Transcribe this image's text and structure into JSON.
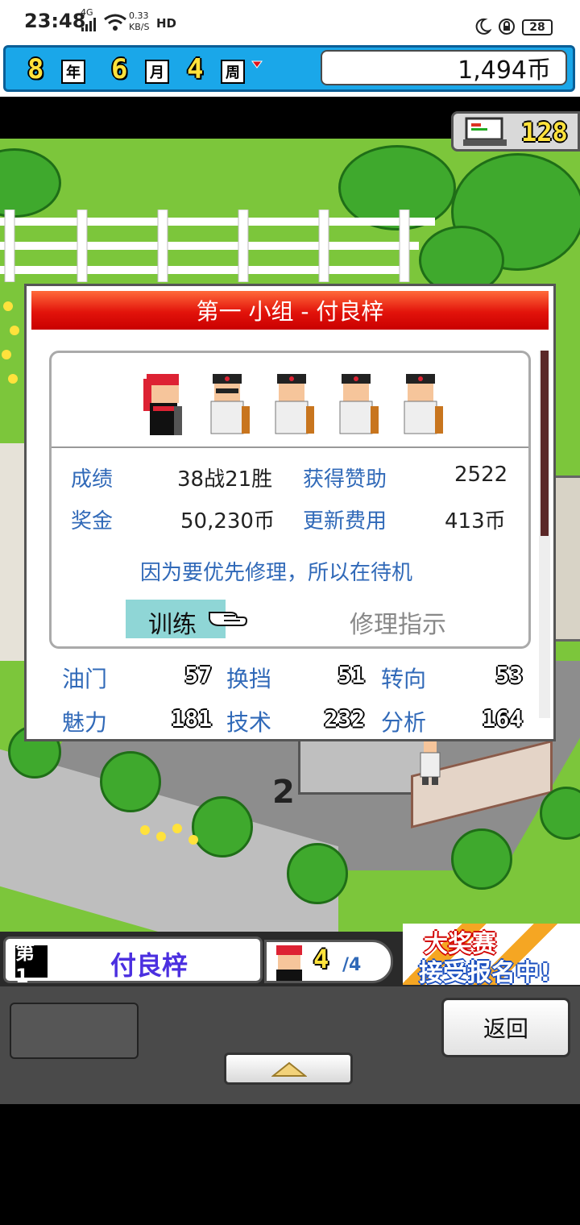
{
  "status_bar": {
    "time": "23:48",
    "network": "4G",
    "speed": "0.33",
    "speed_unit": "KB/S",
    "hd": "HD",
    "battery": "28"
  },
  "date_bar": {
    "year": "8",
    "year_unit": "年",
    "month": "6",
    "month_unit": "月",
    "week": "4",
    "week_unit": "周",
    "coins": "1,494币"
  },
  "research_points": "128",
  "dialog": {
    "title": "第一 小组 - 付良梓",
    "stats": {
      "record_label": "成绩",
      "record_value": "38战21胜",
      "sponsor_label": "获得赞助",
      "sponsor_value": "2522",
      "prize_label": "奖金",
      "prize_value": "50,230币",
      "renewal_label": "更新费用",
      "renewal_value": "413币"
    },
    "status_message": "因为要优先修理，所以在待机",
    "actions": {
      "train": "训练",
      "repair": "修理指示"
    },
    "attributes": [
      {
        "label": "油门",
        "value": "57"
      },
      {
        "label": "换挡",
        "value": "51"
      },
      {
        "label": "转向",
        "value": "53"
      },
      {
        "label": "魅力",
        "value": "181"
      },
      {
        "label": "技术",
        "value": "232"
      },
      {
        "label": "分析",
        "value": "164"
      }
    ]
  },
  "scene": {
    "track_number": "2"
  },
  "hud": {
    "team_badge": "第1",
    "team_name": "付良梓",
    "member_count": "4",
    "member_total": "/4",
    "banner_line1": "大奖赛",
    "banner_line2": "接受报名中!",
    "back_button": "返回"
  }
}
